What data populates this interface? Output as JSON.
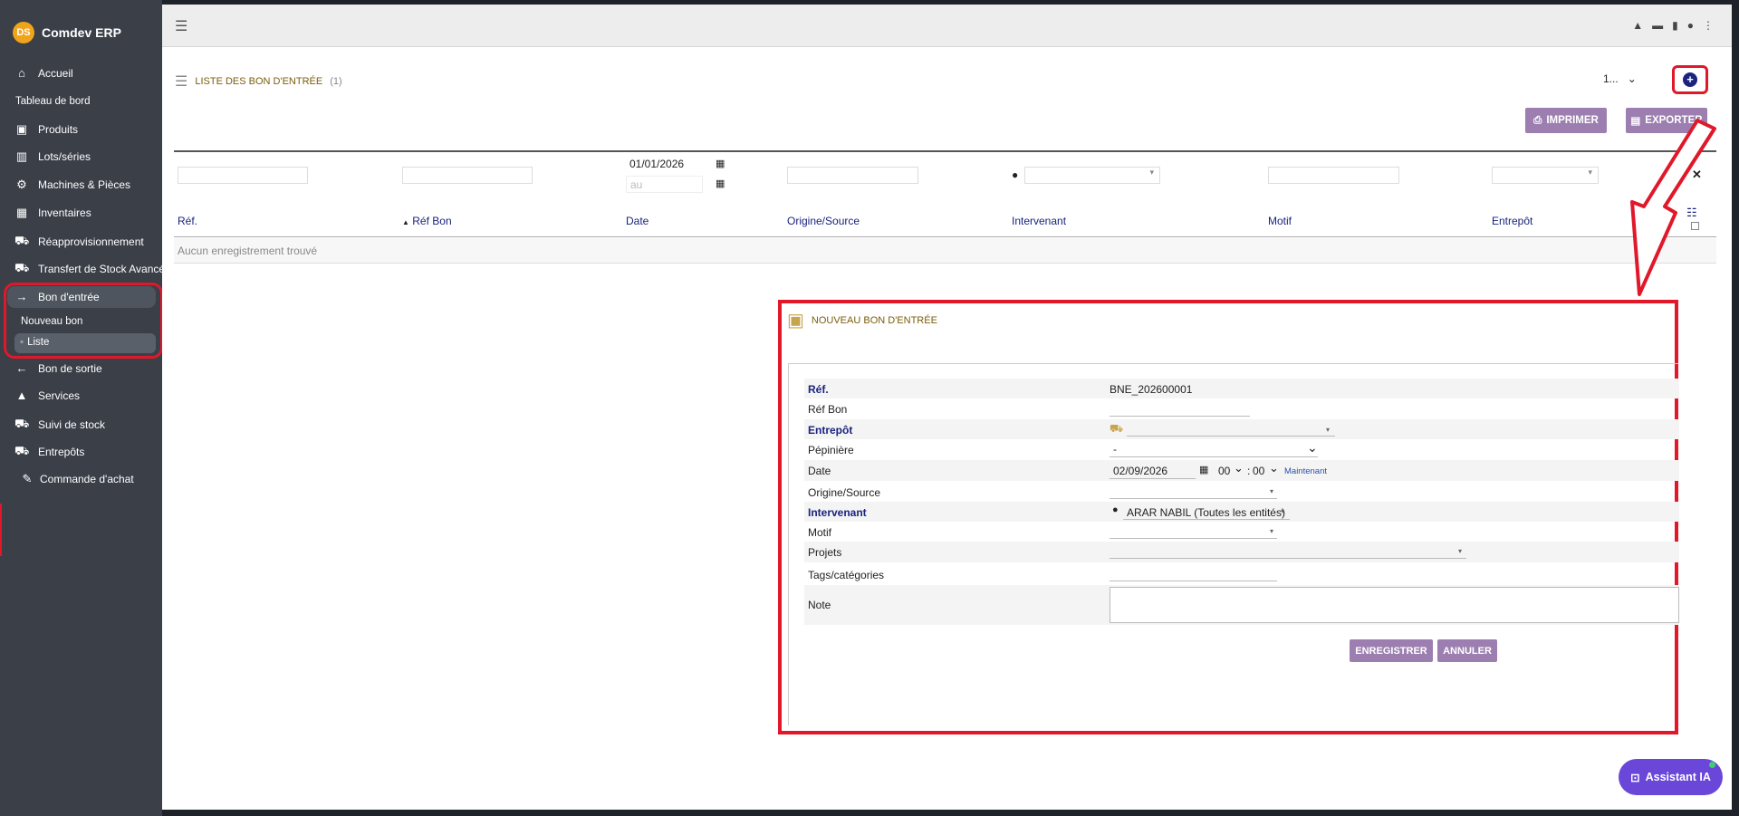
{
  "app": {
    "title": "Comdev ERP",
    "logo_text": "DS"
  },
  "sidebar": {
    "items": [
      {
        "label": "Accueil",
        "icon": "home-icon"
      },
      {
        "label": "Tableau de bord"
      },
      {
        "label": "Produits",
        "icon": "cube-icon"
      },
      {
        "label": "Lots/séries",
        "icon": "barcode-icon"
      },
      {
        "label": "Machines & Pièces",
        "icon": "gears-icon"
      },
      {
        "label": "Inventaires",
        "icon": "boxes-icon"
      },
      {
        "label": "Réapprovisionnement",
        "icon": "truck-icon"
      },
      {
        "label": "Transfert de Stock Avancé",
        "icon": "truck-icon"
      },
      {
        "label": "Bon d'entrée",
        "icon": "arrow-right-icon"
      },
      {
        "label": "Nouveau bon"
      },
      {
        "label": "Liste",
        "bullet": "◦"
      },
      {
        "label": "Bon de sortie",
        "icon": "arrow-left-icon"
      },
      {
        "label": "Services",
        "icon": "bell-icon"
      },
      {
        "label": "Suivi de stock",
        "icon": "truck-icon"
      },
      {
        "label": "Entrepôts",
        "icon": "truck-icon"
      },
      {
        "label": "Commande d'achat",
        "icon": "cart-icon"
      }
    ]
  },
  "header": {
    "list_title": "LISTE DES BON D'ENTRÉE",
    "list_count": "(1)",
    "page_select_value": "1...",
    "print_label": "IMPRIMER",
    "export_label": "EXPORTER"
  },
  "table": {
    "filter_date_from": "01/01/2026",
    "filter_date_to_placeholder": "au",
    "columns": [
      "Réf.",
      "Réf Bon",
      "Date",
      "Origine/Source",
      "Intervenant",
      "Motif",
      "Entrepôt"
    ],
    "sort_indicator": "▲",
    "empty_message": "Aucun enregistrement trouvé"
  },
  "form": {
    "title": "NOUVEAU BON D'ENTRÉE",
    "fields": {
      "ref_label": "Réf.",
      "ref_value": "BNE_202600001",
      "ref_bon_label": "Réf Bon",
      "entrepot_label": "Entrepôt",
      "pepiniere_label": "Pépinière",
      "pepiniere_value": "-",
      "date_label": "Date",
      "date_value": "02/09/2026",
      "hour_value": "00",
      "minute_value": "00",
      "now_link": "Maintenant",
      "origine_label": "Origine/Source",
      "intervenant_label": "Intervenant",
      "intervenant_value": "ARAR NABIL (Toutes les entités)",
      "motif_label": "Motif",
      "projets_label": "Projets",
      "tags_label": "Tags/catégories",
      "note_label": "Note"
    },
    "save_label": "ENREGISTRER",
    "cancel_label": "ANNULER"
  },
  "assistant": {
    "label": "Assistant IA"
  },
  "colors": {
    "sidebar": "#3a3f48",
    "accent_purple": "#9c7fb0",
    "highlight_red": "#e0182a",
    "link_blue": "#1a237e",
    "assistant": "#6a47d8"
  }
}
